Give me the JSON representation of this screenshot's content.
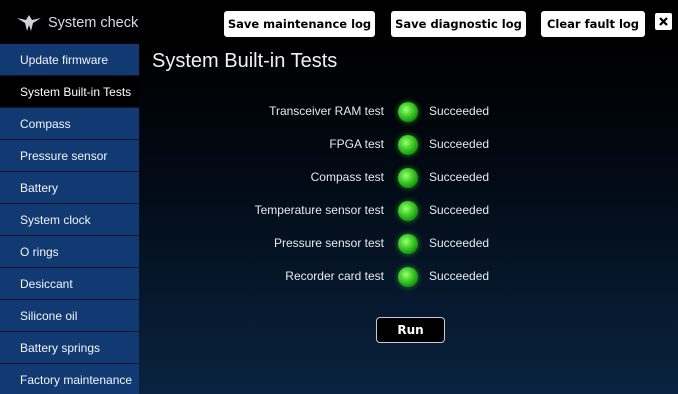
{
  "header": {
    "title": "System check",
    "logo_icon": "teledyne-logo-icon",
    "buttons": {
      "save_maintenance": "Save maintenance log",
      "save_diagnostic": "Save diagnostic log",
      "clear_fault": "Clear fault log"
    },
    "close_icon": "close-icon"
  },
  "sidebar": {
    "items": [
      {
        "label": "Update firmware",
        "active": false
      },
      {
        "label": "System Built-in Tests",
        "active": true
      },
      {
        "label": "Compass",
        "active": false
      },
      {
        "label": "Pressure sensor",
        "active": false
      },
      {
        "label": "Battery",
        "active": false
      },
      {
        "label": "System clock",
        "active": false
      },
      {
        "label": "O rings",
        "active": false
      },
      {
        "label": "Desiccant",
        "active": false
      },
      {
        "label": "Silicone oil",
        "active": false
      },
      {
        "label": "Battery springs",
        "active": false
      },
      {
        "label": "Factory maintenance",
        "active": false
      }
    ]
  },
  "main": {
    "title": "System Built-in Tests",
    "tests": [
      {
        "name": "Transceiver RAM test",
        "status": "Succeeded"
      },
      {
        "name": "FPGA test",
        "status": "Succeeded"
      },
      {
        "name": "Compass test",
        "status": "Succeeded"
      },
      {
        "name": "Temperature sensor test",
        "status": "Succeeded"
      },
      {
        "name": "Pressure sensor test",
        "status": "Succeeded"
      },
      {
        "name": "Recorder card test",
        "status": "Succeeded"
      }
    ],
    "status_color": "#3fd12a",
    "run_label": "Run"
  }
}
